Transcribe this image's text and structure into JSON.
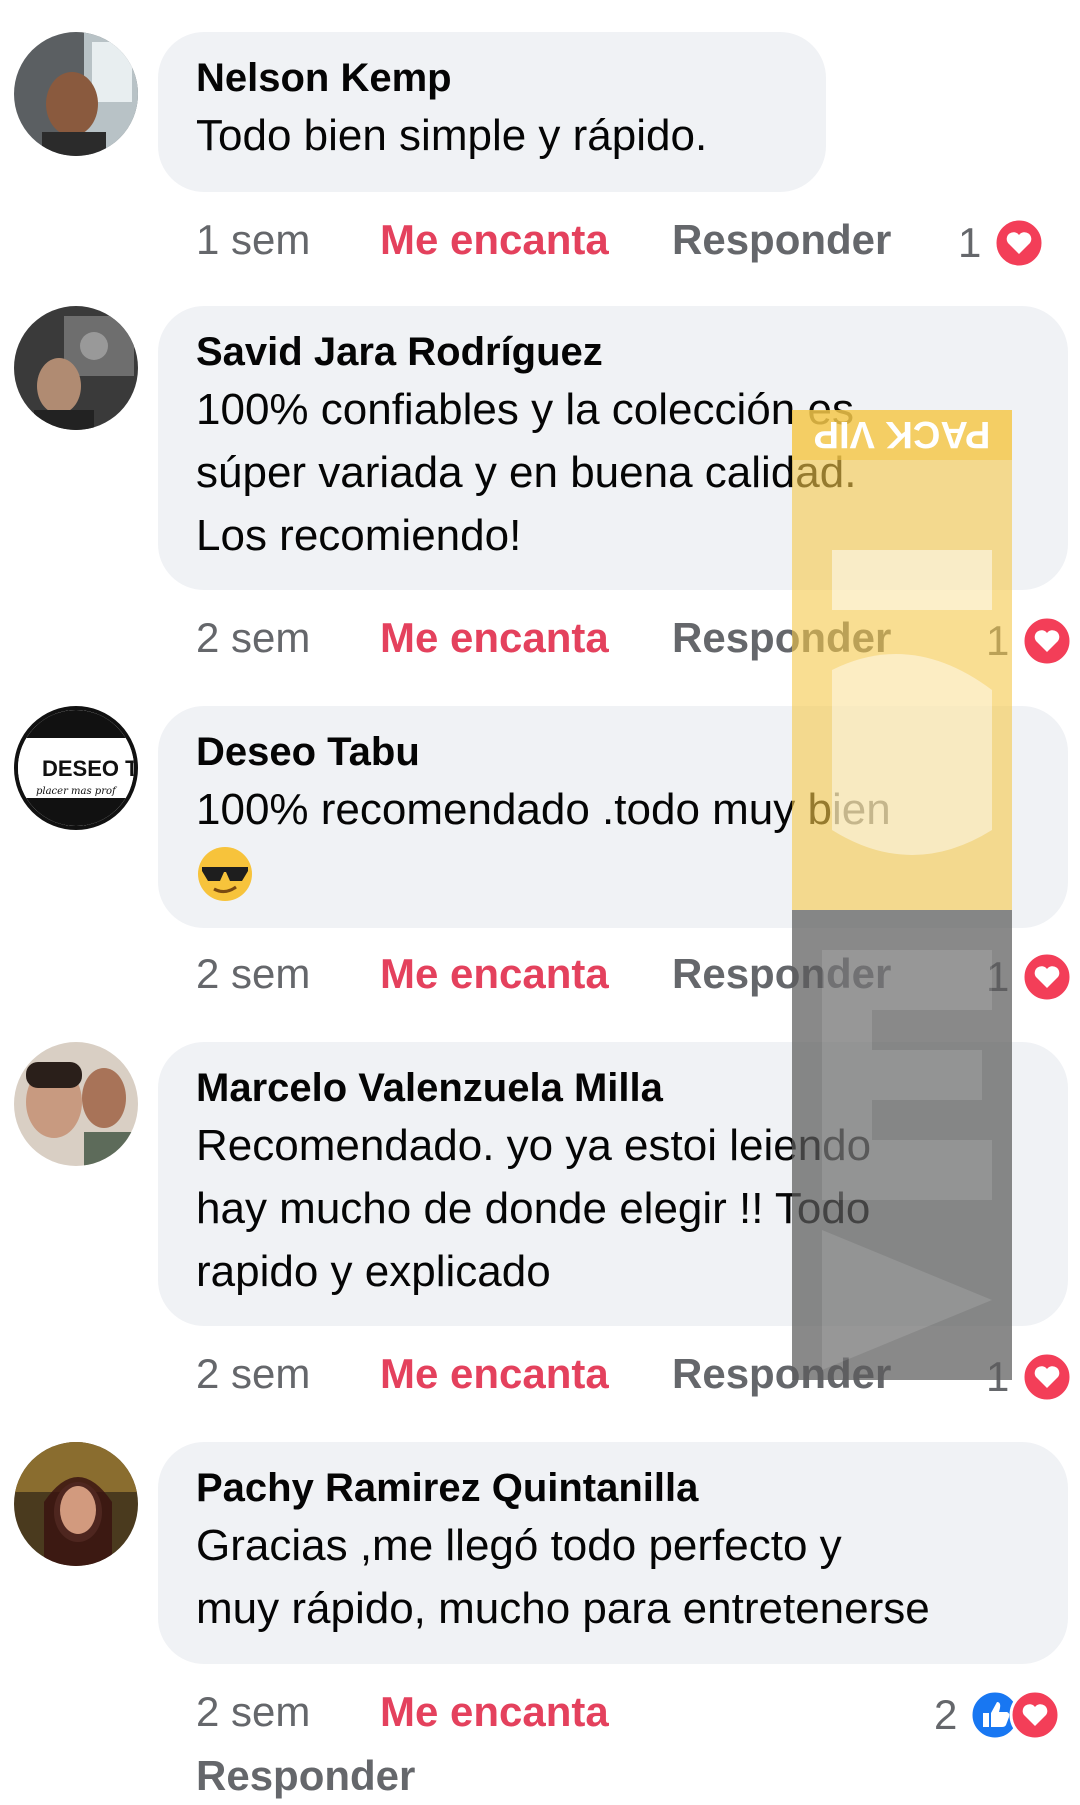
{
  "colors": {
    "bubble": "#f0f2f5",
    "love": "#e4415d",
    "meta": "#65676b",
    "heart": "#f33e58",
    "like": "#1877f2"
  },
  "watermark": {
    "top_text": "PACK VIP",
    "letters": "MEGA"
  },
  "comments": [
    {
      "author": "Nelson Kemp",
      "lines": [
        "Todo bien simple y rápido."
      ],
      "time": "1 sem",
      "love": "Me encanta",
      "reply": "Responder",
      "reaction_count": "1",
      "reaction_icons": [
        "heart-icon"
      ]
    },
    {
      "author": "Savid Jara Rodríguez",
      "lines": [
        "100% confiables y la colección es",
        "súper variada y en buena calidad.",
        "Los recomiendo!"
      ],
      "time": "2 sem",
      "love": "Me encanta",
      "reply": "Responder",
      "reaction_count": "1",
      "reaction_icons": [
        "heart-icon"
      ]
    },
    {
      "author": "Deseo Tabu",
      "avatar_text": "DESEO T/",
      "avatar_sub": "placer mas prof",
      "lines": [
        "100% recomendado .todo muy bien"
      ],
      "emoji": "sunglasses-emoji",
      "time": "2 sem",
      "love": "Me encanta",
      "reply": "Responder",
      "reaction_count": "1",
      "reaction_icons": [
        "heart-icon"
      ]
    },
    {
      "author": "Marcelo Valenzuela Milla",
      "lines": [
        "Recomendado. yo ya estoi leiendo",
        "hay mucho de donde elegir !! Todo",
        "rapido y explicado"
      ],
      "time": "2 sem",
      "love": "Me encanta",
      "reply": "Responder",
      "reaction_count": "1",
      "reaction_icons": [
        "heart-icon"
      ]
    },
    {
      "author": "Pachy Ramirez Quintanilla",
      "lines": [
        "Gracias ,me llegó todo perfecto y",
        "muy rápido, mucho para entretenerse"
      ],
      "time": "2 sem",
      "love": "Me encanta",
      "reply": "Responder",
      "reaction_count": "2",
      "reaction_icons": [
        "like-icon",
        "heart-icon"
      ]
    }
  ]
}
